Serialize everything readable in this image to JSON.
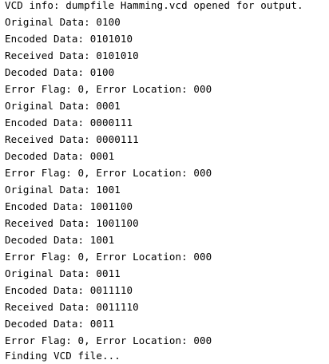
{
  "console": {
    "lines": [
      "VCD info: dumpfile Hamming.vcd opened for output.",
      "Original Data: 0100",
      "Encoded Data: 0101010",
      "Received Data: 0101010",
      "Decoded Data: 0100",
      "Error Flag: 0, Error Location: 000",
      "Original Data: 0001",
      "Encoded Data: 0000111",
      "Received Data: 0000111",
      "Decoded Data: 0001",
      "Error Flag: 0, Error Location: 000",
      "Original Data: 1001",
      "Encoded Data: 1001100",
      "Received Data: 1001100",
      "Decoded Data: 1001",
      "Error Flag: 0, Error Location: 000",
      "Original Data: 0011",
      "Encoded Data: 0011110",
      "Received Data: 0011110",
      "Decoded Data: 0011",
      "Error Flag: 0, Error Location: 000",
      "Finding VCD file..."
    ]
  }
}
